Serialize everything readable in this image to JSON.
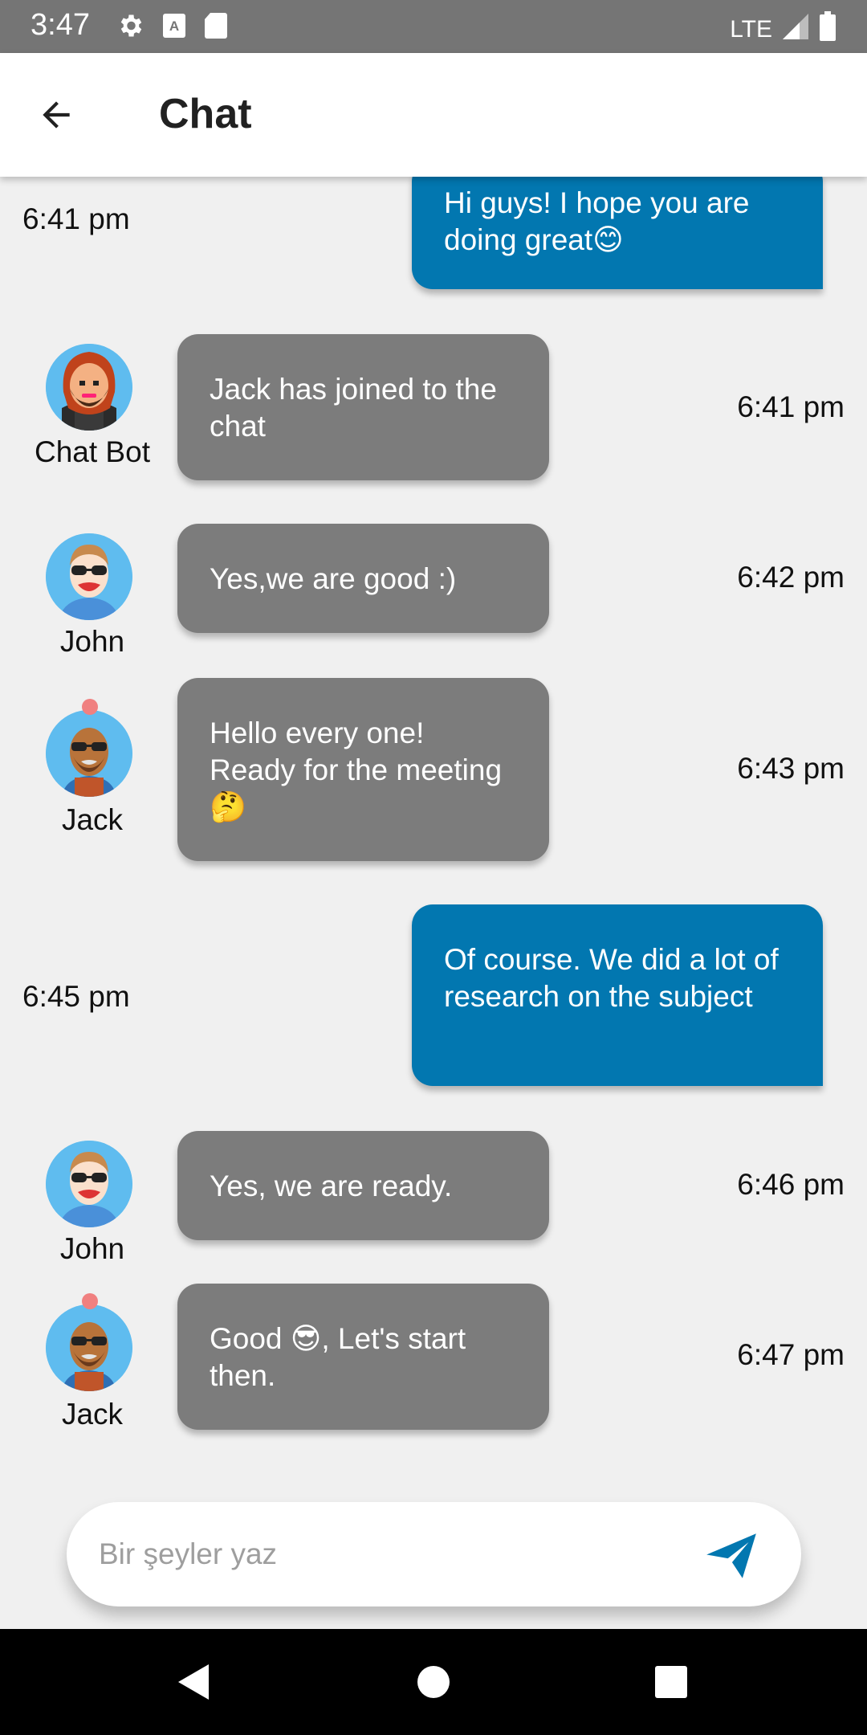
{
  "status_bar": {
    "time": "3:47",
    "network": "LTE"
  },
  "app_bar": {
    "title": "Chat"
  },
  "messages": [
    {
      "type": "out",
      "text": "Hi guys! I hope you are doing great😊",
      "time": "6:41 pm"
    },
    {
      "type": "in",
      "sender": "Chat Bot",
      "avatar": "bot",
      "text": "Jack has joined to the chat",
      "time": "6:41 pm"
    },
    {
      "type": "in",
      "sender": "John",
      "avatar": "john",
      "text": "Yes,we are good :)",
      "time": "6:42 pm"
    },
    {
      "type": "in",
      "sender": "Jack",
      "avatar": "jack",
      "text": "Hello every one! Ready for the meeting🤔",
      "time": "6:43 pm"
    },
    {
      "type": "out",
      "text": "Of course. We did a lot of research on the subject",
      "time": "6:45 pm"
    },
    {
      "type": "in",
      "sender": "John",
      "avatar": "john",
      "text": "Yes, we are ready.",
      "time": "6:46 pm"
    },
    {
      "type": "in",
      "sender": "Jack",
      "avatar": "jack",
      "text": "Good 😎, Let's start then.",
      "time": "6:47 pm"
    }
  ],
  "composer": {
    "placeholder": "Bir şeyler yaz"
  },
  "colors": {
    "incoming_bubble": "#7c7c7c",
    "outgoing_bubble": "#0277b0",
    "avatar_bg": "#5fbcef",
    "send_icon": "#0277b0"
  }
}
